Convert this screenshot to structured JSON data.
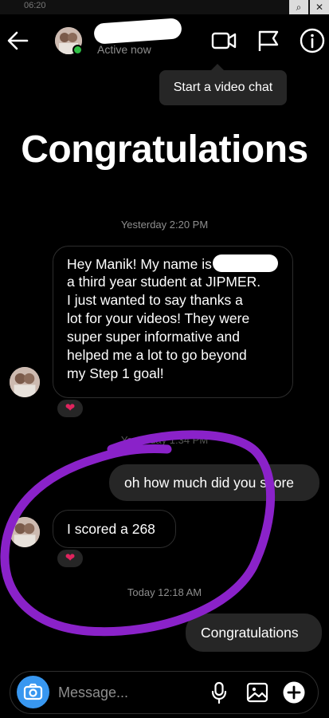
{
  "status_bar": {
    "time": "06:20"
  },
  "header": {
    "status_text": "Active now",
    "tooltip": "Start a video chat"
  },
  "headline": "Congratulations",
  "conversation": {
    "timestamp_1": "Yesterday 2:20 PM",
    "message_1": {
      "line_1_before_redaction": "Hey Manik! My name is",
      "lines": [
        "a third year student at JIPMER.",
        "I just wanted to say thanks a",
        "lot for your videos! They were",
        "super super informative and",
        "helped me a lot to go beyond",
        "my Step 1 goal!"
      ],
      "reaction": "❤"
    },
    "timestamp_2": "Yesterday 1:34 PM",
    "message_2": "oh how much did you score",
    "message_3": {
      "text": "I scored a 268",
      "reaction": "❤"
    },
    "timestamp_3": "Today 12:18 AM",
    "message_4": "Congratulations"
  },
  "composer": {
    "placeholder": "Message..."
  },
  "colors": {
    "accent": "#3897f0",
    "annotation": "#8a22c9",
    "online": "#2fbf45",
    "heart": "#e0245e"
  }
}
